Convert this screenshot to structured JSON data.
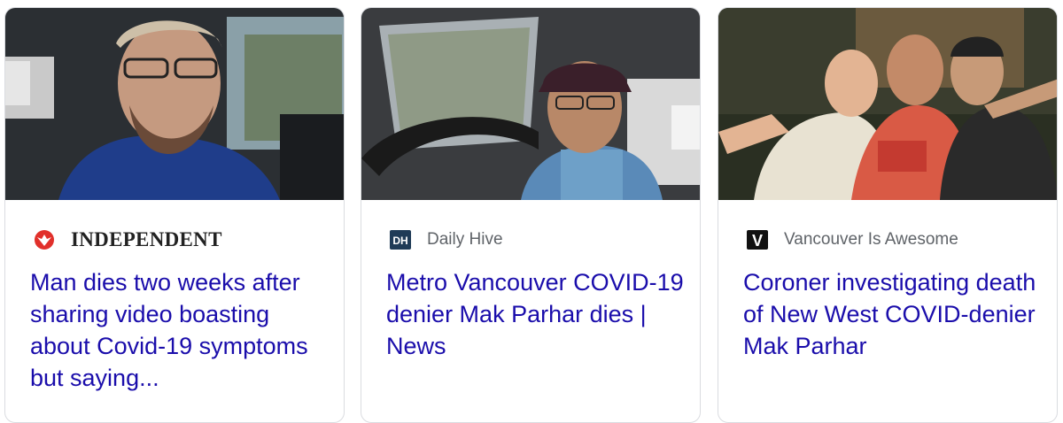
{
  "articles": [
    {
      "source": "INDEPENDENT",
      "source_logo_icon": "eagle-icon",
      "headline": "Man dies two weeks after sharing video boasting about Covid-19 symptoms but saying..."
    },
    {
      "source": "Daily Hive",
      "source_logo_text": "DH",
      "headline": "Metro Vancouver COVID-19 denier Mak Parhar dies | News"
    },
    {
      "source": "Vancouver Is Awesome",
      "source_logo_text": "V",
      "headline": "Coroner investigating death of New West COVID-denier Mak Parhar"
    }
  ],
  "colors": {
    "headline": "#1a0dab",
    "source_text": "#5f6368",
    "independent_red": "#e1302b",
    "daily_hive_bg": "#1f3b57",
    "vancouver_awesome_bg": "#111111"
  }
}
